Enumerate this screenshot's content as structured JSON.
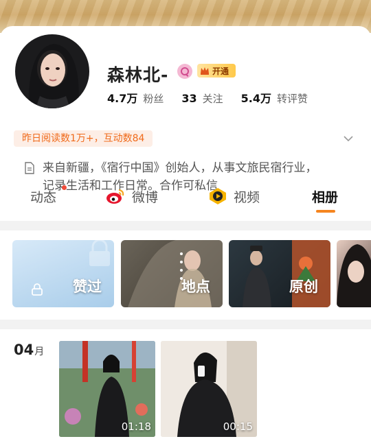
{
  "profile": {
    "name": "森林北-",
    "vip_label": "开通",
    "stats": [
      {
        "num": "4.7万",
        "label": "粉丝"
      },
      {
        "num": "33",
        "label": "关注"
      },
      {
        "num": "5.4万",
        "label": "转评赞"
      }
    ],
    "read_tag": "昨日阅读数1万+，互动数84",
    "bio_line1": "来自新疆，《宿行中国》创始人，从事文旅民宿行业，",
    "bio_line2": "记录生活和工作日常。合作可私信"
  },
  "tabs": {
    "dynamic": "动态",
    "weibo": "微博",
    "video": "视频",
    "album": "相册",
    "active": "album"
  },
  "albums": {
    "liked": "赞过",
    "location": "地点",
    "original": "原创"
  },
  "media": {
    "month_num": "04",
    "month_unit": "月",
    "videos": [
      {
        "duration": "01:18"
      },
      {
        "duration": "00:15"
      }
    ]
  },
  "colors": {
    "accent": "#f5851f",
    "read_tag_text": "#f06a1a",
    "read_tag_bg": "#fdeee6"
  }
}
